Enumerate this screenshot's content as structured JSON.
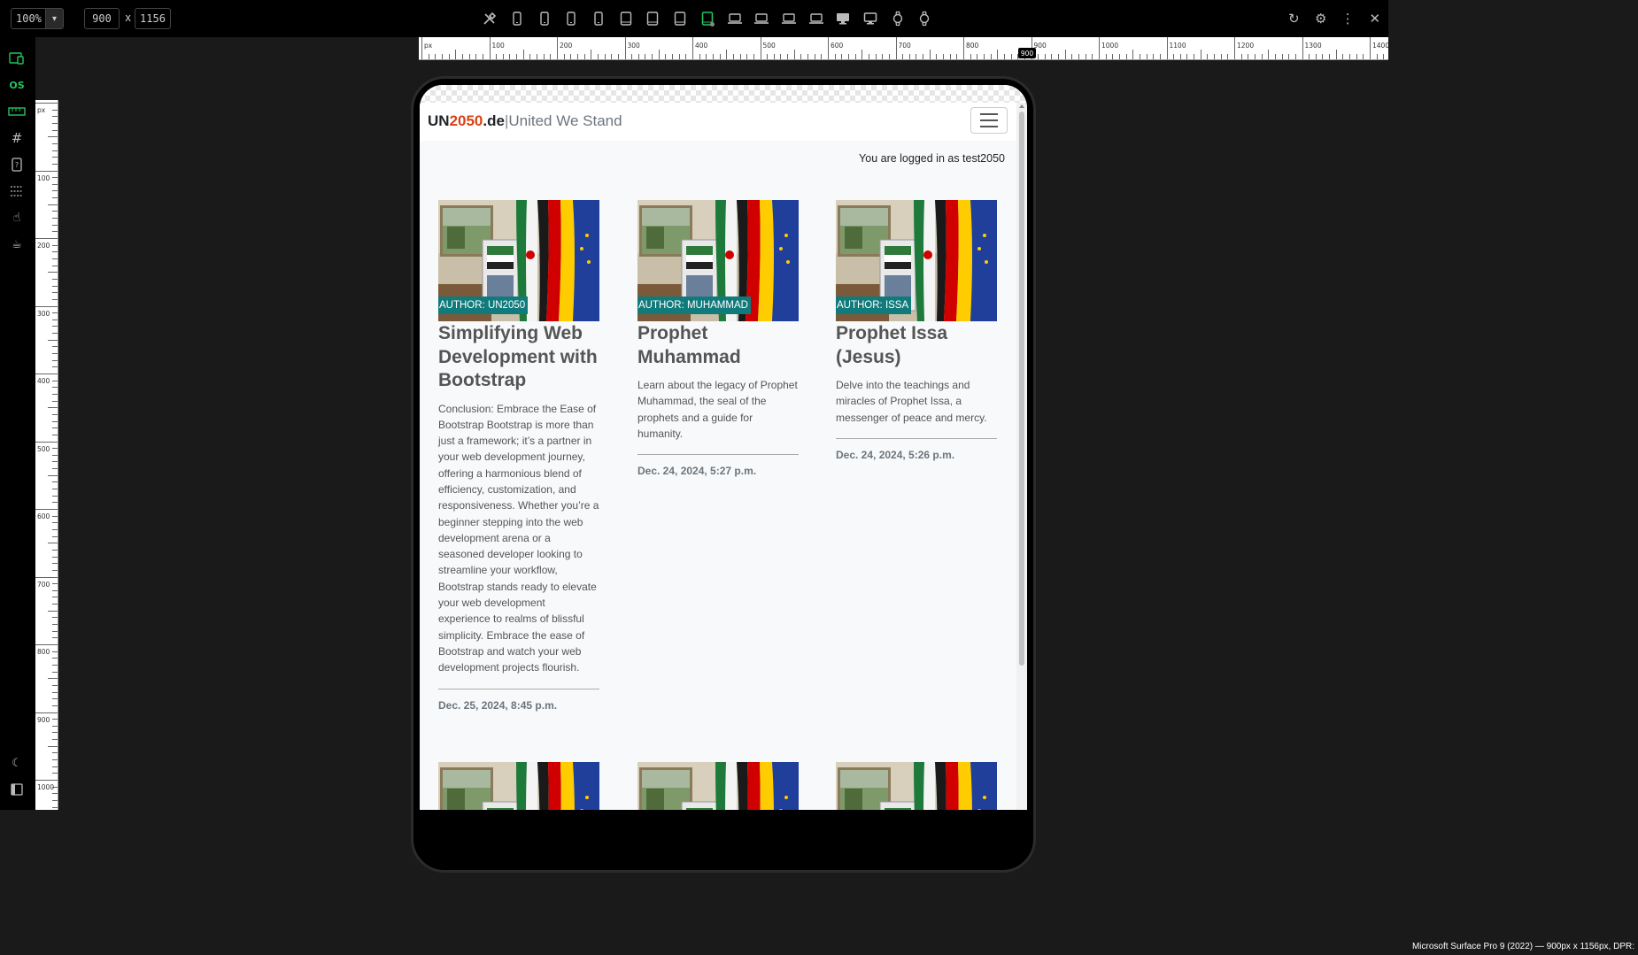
{
  "toolbar": {
    "zoom": "100%",
    "width": "900",
    "height": "1156",
    "dim_separator": "x",
    "device_icons": [
      "tools-icon",
      "phone-icon",
      "phone-icon",
      "phone-icon",
      "phone-icon",
      "tablet-icon",
      "tablet-icon",
      "tablet-icon",
      "tablet-active-icon",
      "laptop-icon",
      "laptop-icon",
      "laptop-icon",
      "laptop-icon",
      "desktop-icon",
      "desktop-icon",
      "watch-icon",
      "watch-icon"
    ],
    "right_icons": [
      "refresh-icon",
      "settings-icon",
      "more-icon",
      "close-icon"
    ]
  },
  "sidebar": {
    "items": [
      "responsive-icon",
      "OS",
      "ruler-icon",
      "grid-icon",
      "device-info-icon",
      "lines-icon",
      "touch-icon",
      "coffee-icon"
    ],
    "os_label": "OS"
  },
  "rulers": {
    "unit": "px",
    "h_labels": [
      "px",
      "100",
      "200",
      "300",
      "400",
      "500",
      "600",
      "700",
      "800",
      "900",
      "1000",
      "1100",
      "1200",
      "1300",
      "1400"
    ],
    "v_labels": [
      "px",
      "100",
      "200",
      "300",
      "400",
      "500",
      "600",
      "700",
      "800",
      "900",
      "1000"
    ],
    "marker": "900"
  },
  "site": {
    "brand_un": "UN",
    "brand_year": "2050",
    "brand_tld": ".de",
    "brand_sep": "|",
    "brand_tag": "United We Stand",
    "login_msg": "You are logged in as test2050"
  },
  "posts": [
    {
      "author": "AUTHOR: UN2050",
      "title": "Simplifying Web Development with Bootstrap",
      "excerpt": "Conclusion: Embrace the Ease of Bootstrap Bootstrap is more than just a framework; it’s a partner in your web development journey, offering a harmonious blend of efficiency, customization, and responsiveness. Whether you’re a beginner stepping into the web development arena or a seasoned developer looking to streamline your workflow, Bootstrap stands ready to elevate your web development experience to realms of blissful simplicity. Embrace the ease of Bootstrap and watch your web development projects flourish.",
      "date": "Dec. 25, 2024, 8:45 p.m."
    },
    {
      "author": "AUTHOR: MUHAMMAD",
      "title": "Prophet Muhammad",
      "excerpt": "Learn about the legacy of Prophet Muhammad, the seal of the prophets and a guide for humanity.",
      "date": "Dec. 24, 2024, 5:27 p.m."
    },
    {
      "author": "AUTHOR: ISSA",
      "title": "Prophet Issa (Jesus)",
      "excerpt": "Delve into the teachings and miracles of Prophet Issa, a messenger of peace and mercy.",
      "date": "Dec. 24, 2024, 5:26 p.m."
    }
  ],
  "status_text": "Microsoft Surface Pro 9 (2022) — 900px x 1156px, DPR:",
  "colors": {
    "accent_green": "#22c55e",
    "brand_orange": "#d84315",
    "author_badge": "#117a7a"
  }
}
